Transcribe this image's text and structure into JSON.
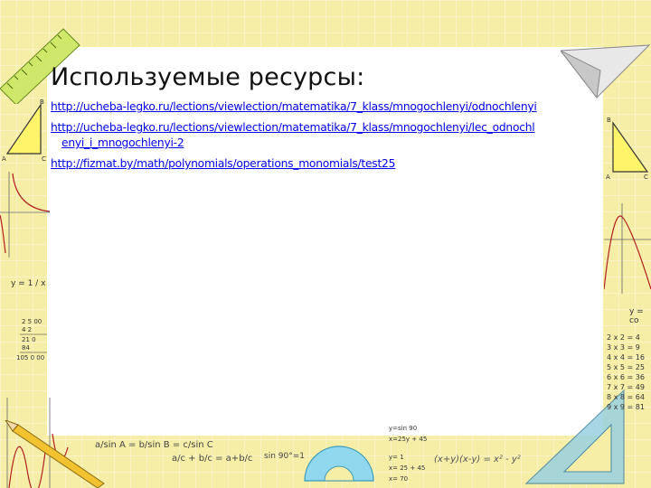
{
  "slide": {
    "title": "Используемые ресурсы:",
    "links": [
      {
        "line1": "http://ucheba-legko.ru/lections/viewlection/matematika/7_klass/mnogochlenyi/odnochlenyi",
        "line2": ""
      },
      {
        "line1": "http://ucheba-legko.ru/lections/viewlection/matematika/7_klass/mnogochlenyi/lec_odnochl",
        "line2": "enyi_i_mnogochlenyi-2"
      },
      {
        "line1": "http://fizmat.by/math/polynomials/operations_monomials/test25",
        "line2": ""
      }
    ]
  },
  "decor": {
    "left_graph_label": "y = 1 / x",
    "right_graph_label": "y = co",
    "multiplication": [
      "2 x 2 = 4",
      "3 x 3 = 9",
      "4 x 4 = 16",
      "5 x 5 = 25",
      "6 x 6 = 36",
      "7 x 7 = 49",
      "8 x 8 = 64",
      "9 x 9 = 81"
    ],
    "sine_rule": "a/sin A = b/sin B = c/sin C",
    "fraction_rule": "a/c + b/c = a+b/c",
    "sin90": "sin 90°=1",
    "system1": [
      "y=sin 90",
      "x=25y + 45"
    ],
    "system2": [
      "y= 1",
      "x= 25 + 45",
      "x= 70"
    ],
    "formula": "(x+y)(x-y) = x² - y²",
    "column_sum": [
      "2 5 00",
      "4 2",
      "21 0",
      "84",
      "105 0 00"
    ]
  }
}
